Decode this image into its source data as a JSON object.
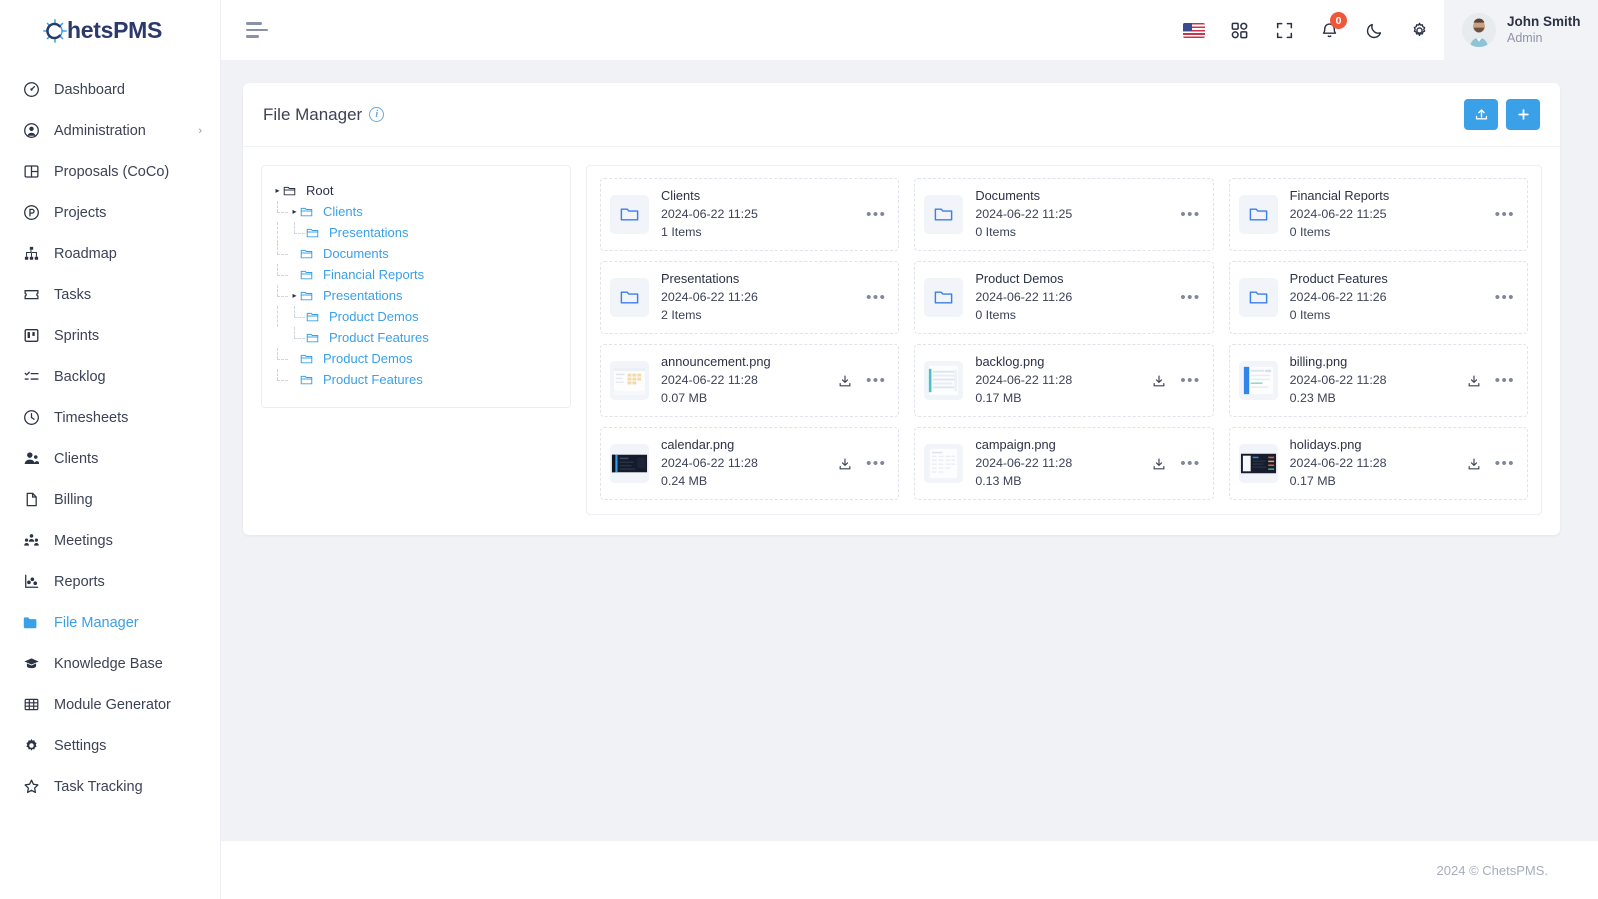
{
  "brand": {
    "name_dark": "hetsPMS",
    "name_accent": "C",
    "full": "ChetsPMS"
  },
  "sidebar": {
    "items": [
      {
        "label": "Dashboard",
        "icon": "gauge-icon",
        "active": false,
        "caret": ""
      },
      {
        "label": "Administration",
        "icon": "user-circle-icon",
        "active": false,
        "caret": "›"
      },
      {
        "label": "Proposals (CoCo)",
        "icon": "layout-icon",
        "active": false,
        "caret": ""
      },
      {
        "label": "Projects",
        "icon": "p-circle-icon",
        "active": false,
        "caret": ""
      },
      {
        "label": "Roadmap",
        "icon": "sitemap-icon",
        "active": false,
        "caret": ""
      },
      {
        "label": "Tasks",
        "icon": "ticket-icon",
        "active": false,
        "caret": ""
      },
      {
        "label": "Sprints",
        "icon": "board-icon",
        "active": false,
        "caret": ""
      },
      {
        "label": "Backlog",
        "icon": "list-check-icon",
        "active": false,
        "caret": ""
      },
      {
        "label": "Timesheets",
        "icon": "clock-icon",
        "active": false,
        "caret": ""
      },
      {
        "label": "Clients",
        "icon": "users-icon",
        "active": false,
        "caret": ""
      },
      {
        "label": "Billing",
        "icon": "file-icon",
        "active": false,
        "caret": ""
      },
      {
        "label": "Meetings",
        "icon": "people-group-icon",
        "active": false,
        "caret": ""
      },
      {
        "label": "Reports",
        "icon": "chart-dots-icon",
        "active": false,
        "caret": ""
      },
      {
        "label": "File Manager",
        "icon": "folder-icon",
        "active": true,
        "caret": ""
      },
      {
        "label": "Knowledge Base",
        "icon": "graduation-icon",
        "active": false,
        "caret": ""
      },
      {
        "label": "Module Generator",
        "icon": "grid-icon",
        "active": false,
        "caret": ""
      },
      {
        "label": "Settings",
        "icon": "gear-icon",
        "active": false,
        "caret": ""
      },
      {
        "label": "Task Tracking",
        "icon": "star-icon",
        "active": false,
        "caret": ""
      }
    ]
  },
  "topbar": {
    "menu_icon": "hamburger-icon",
    "icons": [
      {
        "name": "language-flag-icon",
        "label": ""
      },
      {
        "name": "apps-grid-icon",
        "label": ""
      },
      {
        "name": "fullscreen-icon",
        "label": ""
      },
      {
        "name": "notification-bell-icon",
        "label": ""
      },
      {
        "name": "dark-mode-moon-icon",
        "label": ""
      },
      {
        "name": "gear-icon",
        "label": ""
      }
    ],
    "notification_count": "0",
    "profile": {
      "name": "John Smith",
      "role": "Admin"
    }
  },
  "page": {
    "title": "File Manager",
    "info_glyph": "i",
    "actions": [
      {
        "name": "upload-button",
        "icon": "upload-icon"
      },
      {
        "name": "add-button",
        "icon": "plus-icon"
      }
    ]
  },
  "tree": {
    "nodes": [
      {
        "label": "Root",
        "depth": 0,
        "caret": "▸",
        "root": true
      },
      {
        "label": "Clients",
        "depth": 1,
        "caret": "▸",
        "root": false
      },
      {
        "label": "Presentations",
        "depth": 2,
        "caret": "",
        "root": false
      },
      {
        "label": "Documents",
        "depth": 1,
        "caret": "",
        "root": false
      },
      {
        "label": "Financial Reports",
        "depth": 1,
        "caret": "",
        "root": false
      },
      {
        "label": "Presentations",
        "depth": 1,
        "caret": "▸",
        "root": false
      },
      {
        "label": "Product Demos",
        "depth": 2,
        "caret": "",
        "root": false
      },
      {
        "label": "Product Features",
        "depth": 2,
        "caret": "",
        "root": false
      },
      {
        "label": "Product Demos",
        "depth": 1,
        "caret": "",
        "root": false
      },
      {
        "label": "Product Features",
        "depth": 1,
        "caret": "",
        "root": false
      }
    ]
  },
  "files": {
    "items": [
      {
        "name": "Clients",
        "date": "2024-06-22 11:25",
        "sub": "1 Items",
        "type": "folder",
        "thumb": "folder-blue",
        "download": false
      },
      {
        "name": "Documents",
        "date": "2024-06-22 11:25",
        "sub": "0 Items",
        "type": "folder",
        "thumb": "folder-blue",
        "download": false
      },
      {
        "name": "Financial Reports",
        "date": "2024-06-22 11:25",
        "sub": "0 Items",
        "type": "folder",
        "thumb": "folder-blue",
        "download": false
      },
      {
        "name": "Presentations",
        "date": "2024-06-22 11:26",
        "sub": "2 Items",
        "type": "folder",
        "thumb": "folder-blue",
        "download": false
      },
      {
        "name": "Product Demos",
        "date": "2024-06-22 11:26",
        "sub": "0 Items",
        "type": "folder",
        "thumb": "folder-blue",
        "download": false
      },
      {
        "name": "Product Features",
        "date": "2024-06-22 11:26",
        "sub": "0 Items",
        "type": "folder",
        "thumb": "folder-blue",
        "download": false
      },
      {
        "name": "announcement.png",
        "date": "2024-06-22 11:28",
        "sub": "0.07 MB",
        "type": "image",
        "thumb": "light-table",
        "download": true
      },
      {
        "name": "backlog.png",
        "date": "2024-06-22 11:28",
        "sub": "0.17 MB",
        "type": "image",
        "thumb": "light-lines",
        "download": true
      },
      {
        "name": "billing.png",
        "date": "2024-06-22 11:28",
        "sub": "0.23 MB",
        "type": "image",
        "thumb": "blue-sidebar",
        "download": true
      },
      {
        "name": "calendar.png",
        "date": "2024-06-22 11:28",
        "sub": "0.24 MB",
        "type": "image",
        "thumb": "dark-blue",
        "download": true
      },
      {
        "name": "campaign.png",
        "date": "2024-06-22 11:28",
        "sub": "0.13 MB",
        "type": "image",
        "thumb": "light-grid",
        "download": true
      },
      {
        "name": "holidays.png",
        "date": "2024-06-22 11:28",
        "sub": "0.17 MB",
        "type": "image",
        "thumb": "dark-panel",
        "download": true
      }
    ],
    "more_label": "•••"
  },
  "footer": {
    "text": "2024 © ChetsPMS."
  },
  "colors": {
    "accent": "#3aa0e8",
    "brand_dark": "#2b3a6b",
    "badge": "#f0563a",
    "content_bg": "#f1f2f6"
  }
}
